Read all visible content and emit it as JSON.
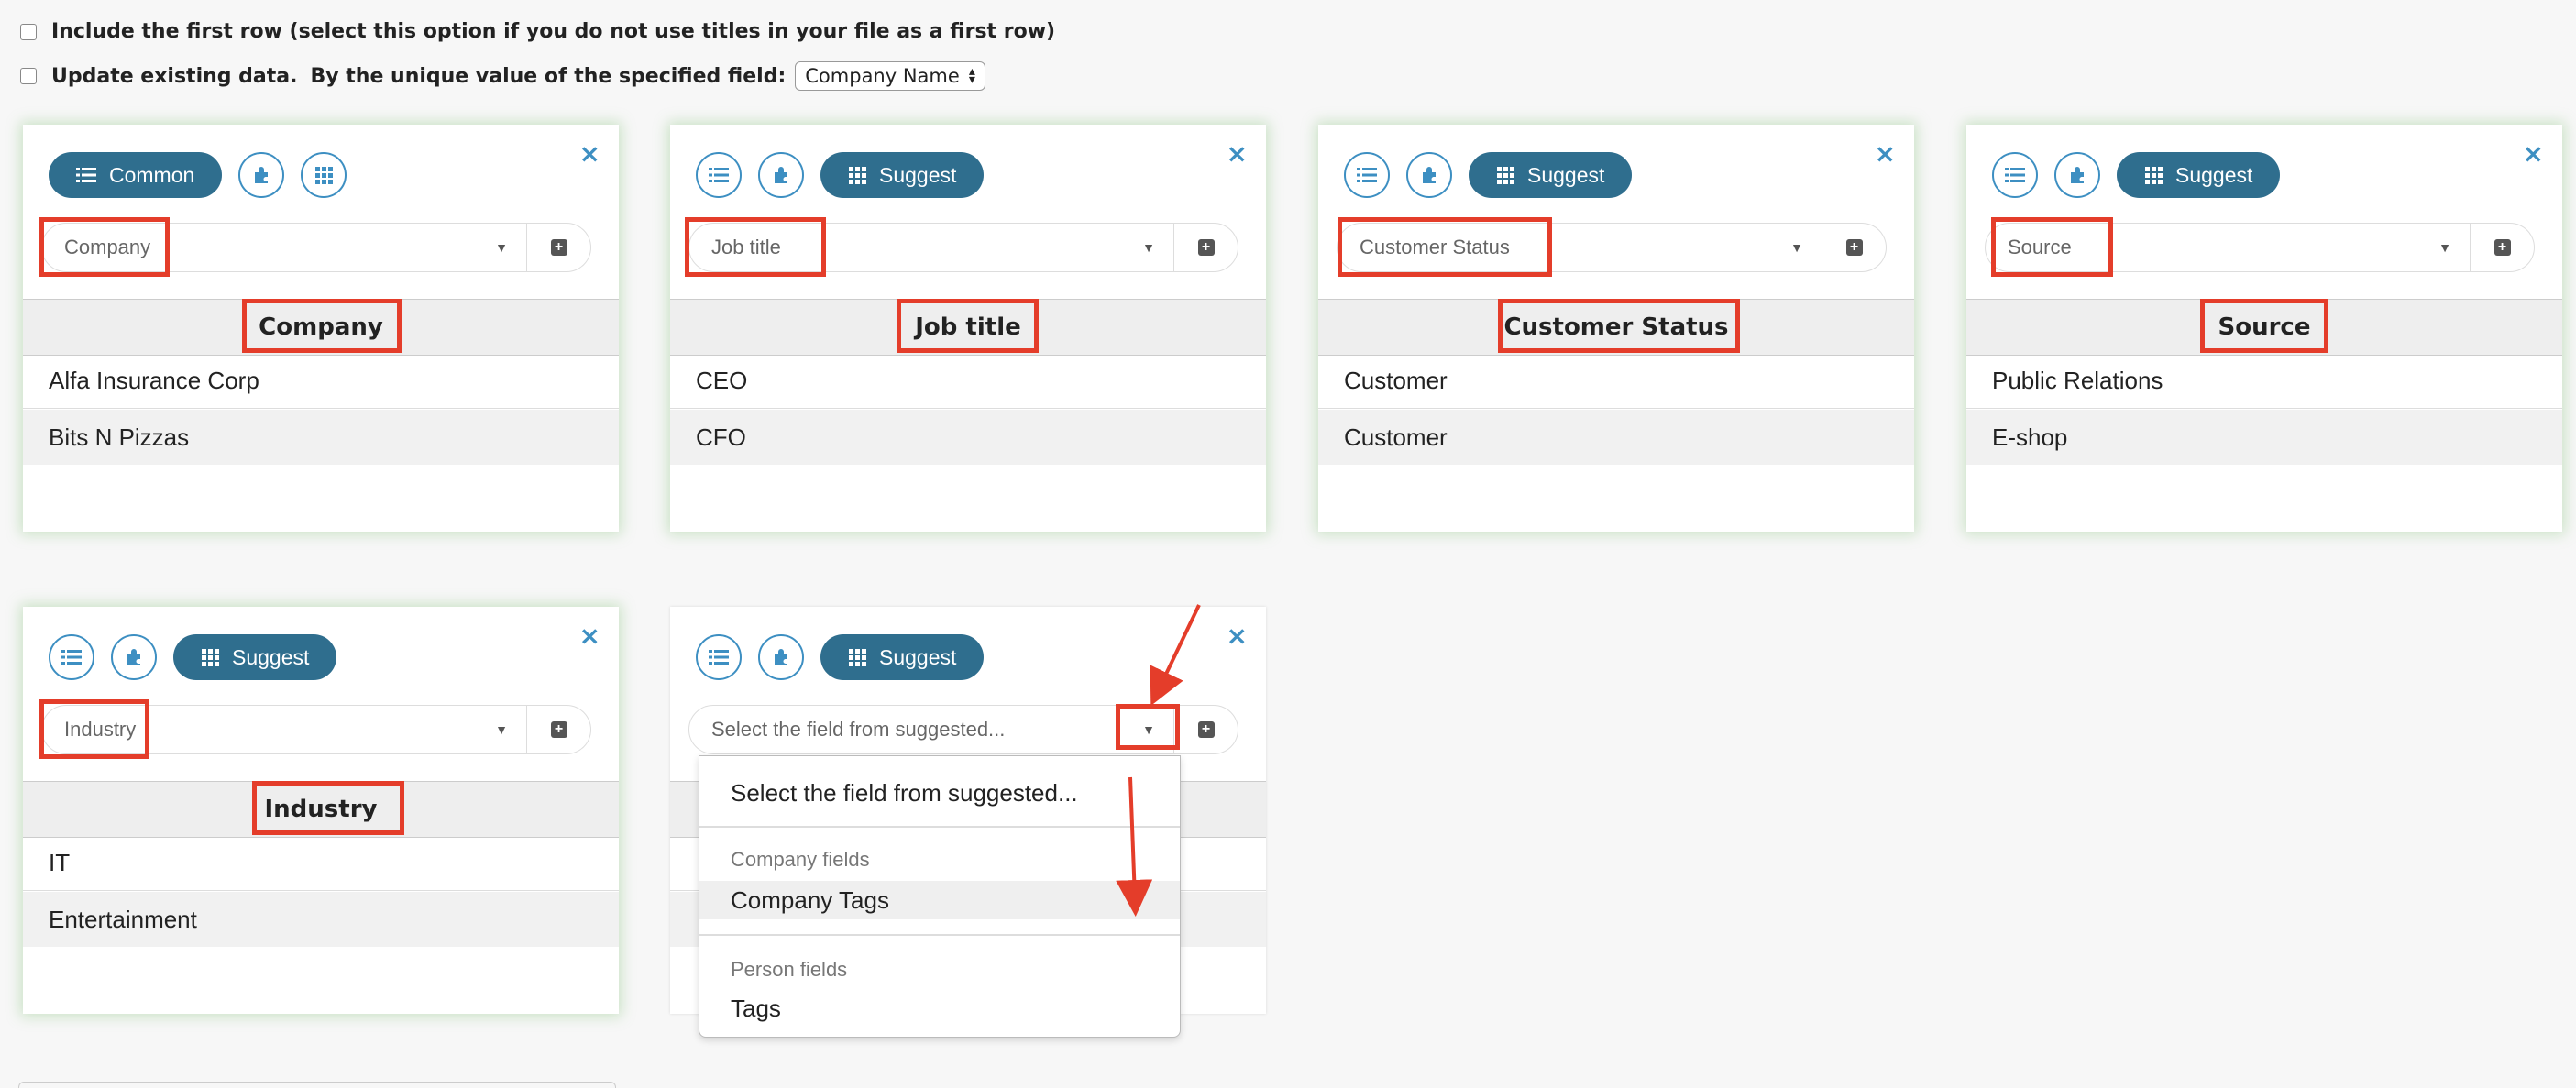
{
  "options": {
    "include_first_row": "Include the first row (select this option if you do not use titles in your file as a first row)",
    "update_existing": "Update existing data.",
    "unique_field_label": "By the unique value of the specified field:",
    "unique_field_value": "Company Name"
  },
  "columns": [
    {
      "button": "Common",
      "field": "Company",
      "header": "Company",
      "values": [
        "Alfa Insurance Corp",
        "Bits N Pizzas"
      ]
    },
    {
      "button": "Suggest",
      "field": "Job title",
      "header": "Job title",
      "values": [
        "CEO",
        "CFO"
      ]
    },
    {
      "button": "Suggest",
      "field": "Customer Status",
      "header": "Customer Status",
      "values": [
        "Customer",
        "Customer"
      ]
    },
    {
      "button": "Suggest",
      "field": "Source",
      "header": "Source",
      "values": [
        "Public Relations",
        "E-shop"
      ]
    },
    {
      "button": "Suggest",
      "field": "Industry",
      "header": "Industry",
      "values": [
        "IT",
        "Entertainment"
      ]
    },
    {
      "button": "Suggest",
      "field_placeholder": "Select the field from suggested...",
      "header": "",
      "values": [
        "",
        ""
      ]
    }
  ],
  "dropdown": {
    "first": "Select the field from suggested...",
    "group1": "Company fields",
    "item1": "Company Tags",
    "group2": "Person fields",
    "item2": "Tags"
  },
  "colors": {
    "accent": "#2f6e8e",
    "link": "#3d8fc2",
    "highlight": "#e43d2a"
  },
  "icons": [
    "list-icon",
    "puzzle-icon",
    "grid-icon",
    "close-icon",
    "plus-icon",
    "caret-down-icon"
  ]
}
